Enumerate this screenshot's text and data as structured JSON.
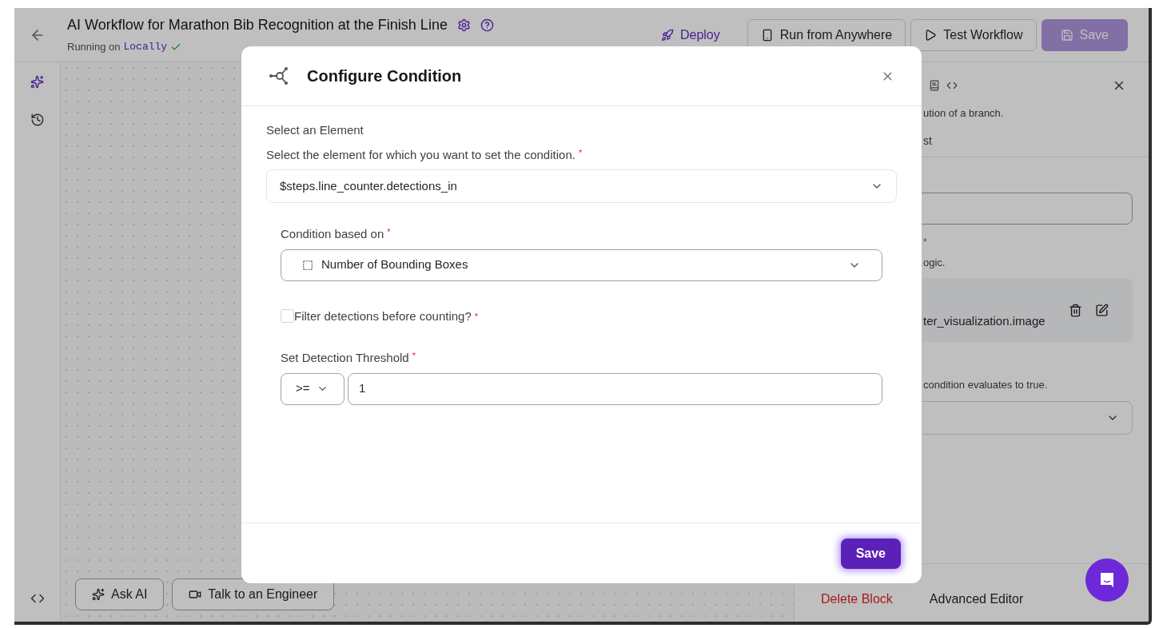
{
  "header": {
    "title": "AI Workflow for Marathon Bib Recognition at the Finish Line",
    "running_label": "Running on",
    "runtime": "Locally",
    "actions": [
      {
        "label": "Deploy",
        "kind": "link"
      },
      {
        "label": "Run from Anywhere",
        "kind": "outline"
      },
      {
        "label": "Test Workflow",
        "kind": "outline"
      },
      {
        "label": "Save",
        "kind": "primary",
        "disabled": true
      }
    ]
  },
  "canvas": {
    "buttons": [
      {
        "label": "Ask AI",
        "kind": "ai"
      },
      {
        "label": "Talk to an Engineer",
        "kind": "video"
      }
    ]
  },
  "side_panel": {
    "description": "ution of a branch.",
    "tab": "st",
    "required_mark": "*",
    "hint": "ogic.",
    "condition_card": "ter_visualization.image",
    "next_hint": "condition evaluates to true.",
    "footer": [
      {
        "label": "Delete Block",
        "kind": "danger"
      },
      {
        "label": "Advanced Editor",
        "kind": "plain"
      }
    ]
  },
  "modal": {
    "title": "Configure Condition",
    "element_label": "Select an Element",
    "element_hint": "Select the element for which you want to set the condition.",
    "element_hint_mark": "*",
    "element_value": "$steps.line_counter.detections_in",
    "condition_label": "Condition based on",
    "condition_mark": "*",
    "condition_value": "Number of Bounding Boxes",
    "filter": {
      "label": "Filter detections before counting?",
      "mark": "*",
      "checked": false
    },
    "threshold_label": "Set Detection Threshold",
    "threshold_mark": "*",
    "operator": ">=",
    "threshold_value": "1",
    "save": "Save"
  }
}
